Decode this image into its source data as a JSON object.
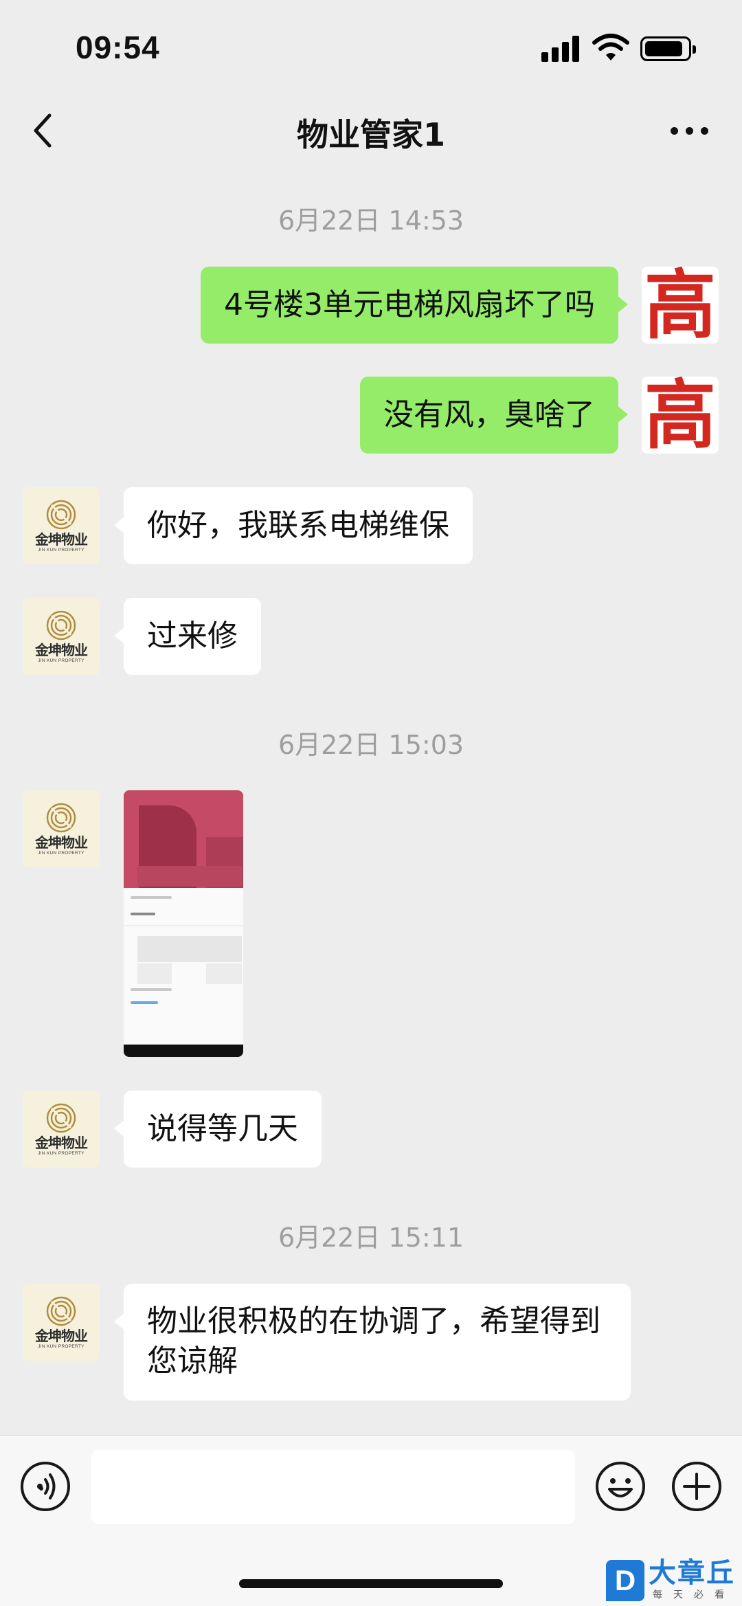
{
  "status_bar": {
    "time": "09:54"
  },
  "header": {
    "title": "物业管家1"
  },
  "timestamps": [
    "6月22日 14:53",
    "6月22日 15:03",
    "6月22日 15:11"
  ],
  "messages": [
    {
      "side": "out",
      "text": "4号楼3单元电梯风扇坏了吗"
    },
    {
      "side": "out",
      "text": "没有风，臭啥了"
    },
    {
      "side": "in",
      "text": "你好，我联系电梯维保"
    },
    {
      "side": "in",
      "text": "过来修"
    },
    {
      "side": "in",
      "type": "image"
    },
    {
      "side": "in",
      "text": "说得等几天"
    },
    {
      "side": "in",
      "text": "物业很积极的在协调了，希望得到您谅解"
    }
  ],
  "avatars": {
    "self": {
      "char": "高",
      "color": "#d3271f"
    },
    "contact": {
      "logo_cn": "金坤物业",
      "logo_en": "JIN KUN PROPERTY",
      "icon": "jk-logo-icon"
    }
  },
  "input_bar": {
    "value": ""
  },
  "watermark": {
    "badge": "D",
    "title": "大章丘",
    "subtitle": "每天必看"
  },
  "colors": {
    "outgoing_bubble": "#95ec69",
    "incoming_bubble": "#ffffff",
    "background": "#ededed"
  }
}
